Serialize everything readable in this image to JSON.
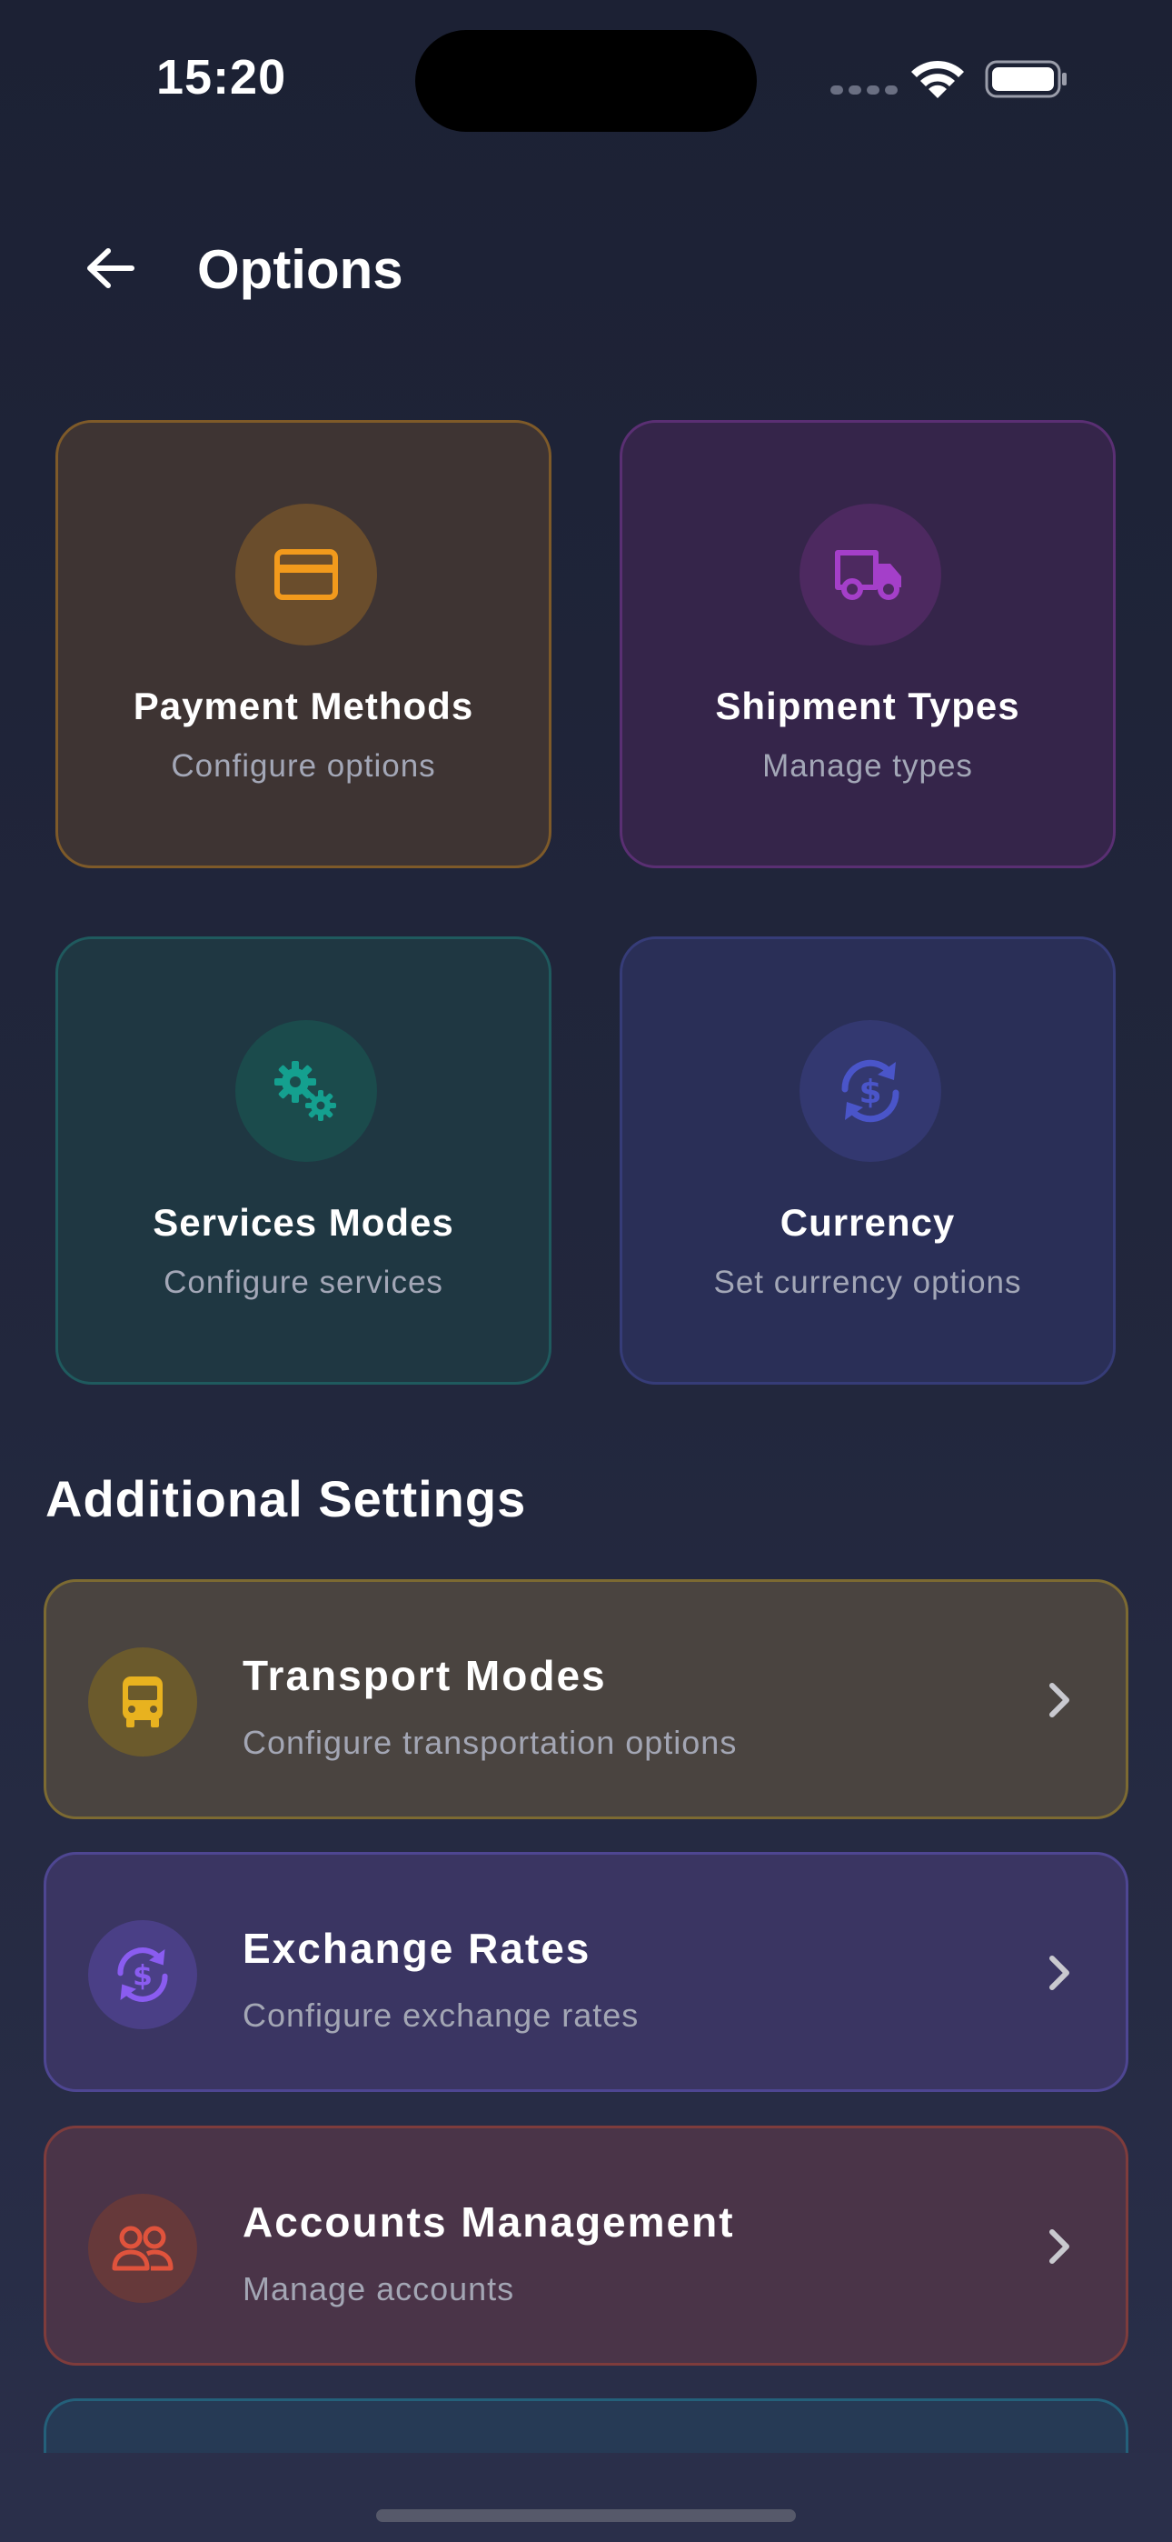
{
  "status_bar": {
    "time": "15:20"
  },
  "header": {
    "title": "Options"
  },
  "cards": [
    {
      "title": "Payment Methods",
      "subtitle": "Configure options",
      "icon": "credit-card-icon",
      "color": "#f29a1c"
    },
    {
      "title": "Shipment Types",
      "subtitle": "Manage types",
      "icon": "truck-icon",
      "color": "#a43fc9"
    },
    {
      "title": "Services Modes",
      "subtitle": "Configure services",
      "icon": "gears-icon",
      "color": "#14a08f"
    },
    {
      "title": "Currency",
      "subtitle": "Set currency options",
      "icon": "currency-exchange-icon",
      "color": "#4a55c9"
    }
  ],
  "section": {
    "title": "Additional Settings"
  },
  "list_items": [
    {
      "title": "Transport Modes",
      "subtitle": "Configure transportation options",
      "icon": "bus-icon",
      "color": "#e8b21f"
    },
    {
      "title": "Exchange Rates",
      "subtitle": "Configure exchange rates",
      "icon": "currency-exchange-icon",
      "color": "#8a5cf0"
    },
    {
      "title": "Accounts Management",
      "subtitle": "Manage accounts",
      "icon": "users-icon",
      "color": "#e0533c"
    }
  ]
}
